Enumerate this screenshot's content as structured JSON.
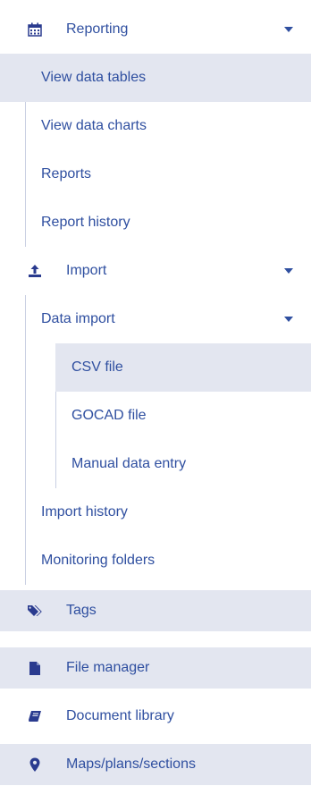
{
  "nav": {
    "reporting": {
      "label": "Reporting",
      "icon": "calendar-icon",
      "items": [
        {
          "label": "View data tables",
          "active": true
        },
        {
          "label": "View data charts"
        },
        {
          "label": "Reports"
        },
        {
          "label": "Report history"
        }
      ]
    },
    "import": {
      "label": "Import",
      "icon": "upload-icon",
      "data_import": {
        "label": "Data import",
        "items": [
          {
            "label": "CSV file",
            "active": true
          },
          {
            "label": "GOCAD file"
          },
          {
            "label": "Manual data entry"
          }
        ]
      },
      "import_history": "Import history",
      "monitoring_folders": "Monitoring folders"
    },
    "tags": {
      "label": "Tags",
      "icon": "tags-icon"
    },
    "file_manager": {
      "label": "File manager",
      "icon": "file-icon"
    },
    "document_library": {
      "label": "Document library",
      "icon": "book-icon"
    },
    "maps": {
      "label": "Maps/plans/sections",
      "icon": "map-marker-icon"
    }
  },
  "colors": {
    "text": "#2f4fa0",
    "highlight": "#e3e6f0",
    "guide": "#c9cfe2"
  }
}
